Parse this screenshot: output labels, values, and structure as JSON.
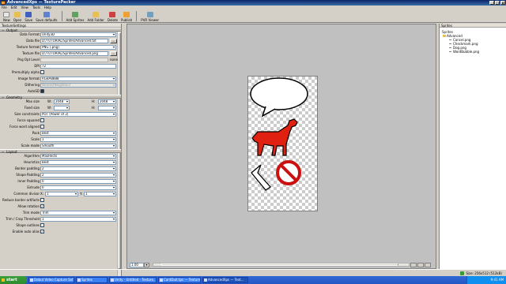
{
  "window": {
    "title": "AdvancedXps — TexturePacker"
  },
  "menu": [
    "File",
    "Edit",
    "View",
    "Tools",
    "Help"
  ],
  "toolbar": {
    "left": [
      {
        "label": "New",
        "icon": "new-icon",
        "color": "#e8e8e8"
      },
      {
        "label": "Open",
        "icon": "open-icon",
        "color": "#e8c050"
      },
      {
        "label": "Save",
        "icon": "save-icon",
        "color": "#4060c0"
      },
      {
        "label": "Save defaults",
        "icon": "save-defaults-icon",
        "color": "#6080d0"
      }
    ],
    "right": [
      {
        "label": "Add Sprites",
        "icon": "add-sprites-icon",
        "color": "#60a060"
      },
      {
        "label": "Add Folder",
        "icon": "add-folder-icon",
        "color": "#e8c050"
      },
      {
        "label": "Delete",
        "icon": "delete-icon",
        "color": "#d04040"
      },
      {
        "label": "Publish",
        "icon": "publish-icon",
        "color": "#f0a030"
      }
    ],
    "viewer": {
      "label": "PVR Viewer",
      "icon": "pvr-viewer-icon",
      "color": "#70a0c0"
    }
  },
  "settings": {
    "header": "TextureSettings",
    "sections": {
      "output": "Output",
      "geometry": "Geometry",
      "layout": "Layout"
    },
    "data_format": {
      "label": "Data Format",
      "value": "Unity3D"
    },
    "data_file": {
      "label": "Data file",
      "value": "D:/TUTORIAL/Sprites/Advanced.txt"
    },
    "texture_format": {
      "label": "Texture format",
      "value": "PNG (.png)"
    },
    "texture_file": {
      "label": "Texture file",
      "value": "D:/TUTORIAL/Sprites/Advanced.png"
    },
    "png_opt_level": {
      "label": "Png Opt Level",
      "value": "none"
    },
    "dpi": {
      "label": "DPI",
      "value": "72"
    },
    "premultiply_alpha": {
      "label": "Premultiply alpha"
    },
    "image_format": {
      "label": "Image format",
      "value": "RGBA8888"
    },
    "dithering": {
      "label": "Dithering",
      "value": "NearestNeighbour"
    },
    "auto_sd": {
      "label": "AutoSD"
    },
    "max_size": {
      "label": "Max size",
      "w_label": "W:",
      "w": "2048",
      "h_label": "H:",
      "h": "2048"
    },
    "fixed_size": {
      "label": "Fixed size",
      "w_label": "W:",
      "h_label": "H:"
    },
    "size_constraints": {
      "label": "Size constraints",
      "value": "POT (Power of 2)"
    },
    "force_squared": {
      "label": "Force squared"
    },
    "force_word_aligned": {
      "label": "Force word aligned"
    },
    "pack": {
      "label": "Pack",
      "value": "Best"
    },
    "scale": {
      "label": "Scale",
      "value": "1"
    },
    "scale_mode": {
      "label": "Scale mode",
      "value": "Smooth"
    },
    "algorithm": {
      "label": "Algorithm",
      "value": "MaxRects"
    },
    "heuristics": {
      "label": "Heuristics",
      "value": "Best"
    },
    "border_padding": {
      "label": "Border padding",
      "value": "2"
    },
    "shape_padding": {
      "label": "Shape Padding",
      "value": "2"
    },
    "inner_padding": {
      "label": "Inner Padding",
      "value": "0"
    },
    "extrude": {
      "label": "Extrude",
      "value": "0"
    },
    "common_divisor": {
      "label": "Common divisor",
      "x_label": "X:",
      "x": "1",
      "y_label": "Y:",
      "y": "1"
    },
    "reduce_border_artifacts": {
      "label": "Reduce border artifacts"
    },
    "allow_rotation": {
      "label": "Allow rotation"
    },
    "trim_mode": {
      "label": "Trim mode",
      "value": "Trim"
    },
    "trim_threshold": {
      "label": "Trim / Crop Threshold",
      "value": "1"
    },
    "shape_outlines": {
      "label": "Shape outlines"
    },
    "enable_auto_alias": {
      "label": "Enable auto alias"
    }
  },
  "canvas": {
    "zoom": "1.00"
  },
  "sprites_panel": {
    "header": "Sprites",
    "root": "Sprites",
    "folder": "Advanced",
    "files": [
      "Cancel.png",
      "Checkmark.png",
      "Dog.png",
      "WordBubble.png"
    ]
  },
  "status": {
    "text": "Size: 256x512 (512kB)"
  },
  "taskbar": {
    "start": "start",
    "tasks": [
      "Debut Video Capture Sof...",
      "Sprites",
      "Unity - Untitled - Texture...",
      "CardDuit.tps — Texture...",
      "AdvancedXps — Text..."
    ],
    "clock": "9:41 AM"
  },
  "colors": {
    "dog": "#e02010",
    "cancel": "#cc1010",
    "accent": "#0a246a"
  }
}
